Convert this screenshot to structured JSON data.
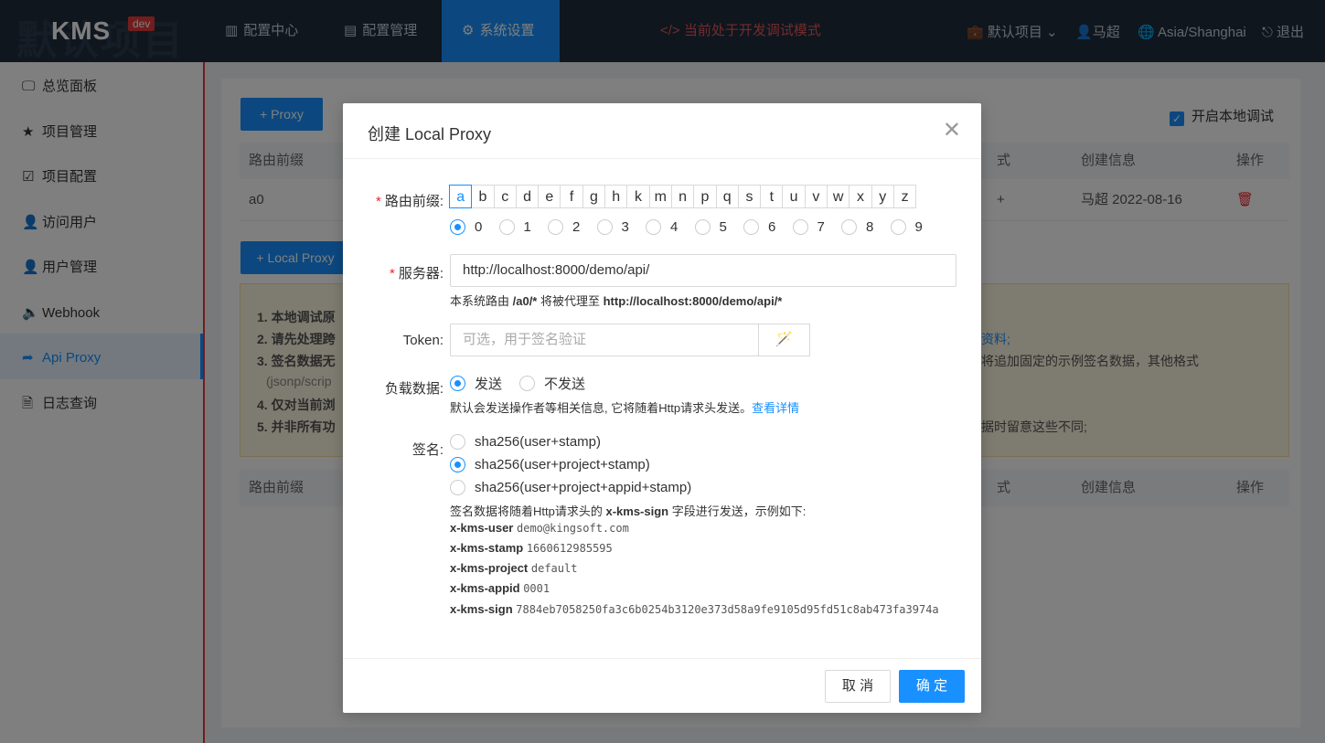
{
  "topbar": {
    "logo_watermark": "默认项目",
    "logo_text": "KMS",
    "logo_badge": "dev",
    "tabs": [
      {
        "icon": "▥",
        "label": "配置中心"
      },
      {
        "icon": "▤",
        "label": "配置管理"
      },
      {
        "icon": "⚙",
        "label": "系统设置"
      }
    ],
    "dev_mode": "</> 当前处于开发调试模式",
    "project": "默认项目",
    "user": "马超",
    "timezone": "Asia/Shanghai",
    "logout": "退出"
  },
  "sidebar": {
    "items": [
      {
        "icon": "🖵",
        "label": "总览面板"
      },
      {
        "icon": "★",
        "label": "项目管理"
      },
      {
        "icon": "☑",
        "label": "项目配置"
      },
      {
        "icon": "👤",
        "label": "访问用户"
      },
      {
        "icon": "👤",
        "label": "用户管理"
      },
      {
        "icon": "🔈",
        "label": "Webhook"
      },
      {
        "icon": "➦",
        "label": "Api Proxy"
      },
      {
        "icon": "🗎",
        "label": "日志查询"
      }
    ]
  },
  "background": {
    "add_proxy": "+ Proxy",
    "add_local_proxy": "+ Local Proxy",
    "local_debug": "开启本地调试",
    "table1": {
      "headers": [
        "路由前缀",
        "式",
        "创建信息",
        "操作"
      ],
      "row": [
        "a0",
        "+",
        "马超 2022-08-16"
      ]
    },
    "notice": [
      "1. 本地调试原",
      "2. 请先处理跨",
      "3. 签名数据无",
      "(jsonp/scrip",
      "4. 仅对当前浏",
      "5. 并非所有功"
    ],
    "notice_right": [
      "资料;",
      "将追加固定的示例签名数据，其他格式",
      "据时留意这些不同;"
    ],
    "table2_headers": [
      "路由前缀",
      "式",
      "创建信息",
      "操作"
    ]
  },
  "modal": {
    "title": "创建 Local Proxy",
    "prefix_label": "路由前缀:",
    "letters": [
      "a",
      "b",
      "c",
      "d",
      "e",
      "f",
      "g",
      "h",
      "k",
      "m",
      "n",
      "p",
      "q",
      "s",
      "t",
      "u",
      "v",
      "w",
      "x",
      "y",
      "z"
    ],
    "selected_letter": "a",
    "digits": [
      "0",
      "1",
      "2",
      "3",
      "4",
      "5",
      "6",
      "7",
      "8",
      "9"
    ],
    "selected_digit": "0",
    "server_label": "服务器:",
    "server_value": "http://localhost:8000/demo/api/",
    "server_hint_pre": "本系统路由 ",
    "server_hint_route": "/a0/*",
    "server_hint_mid": " 将被代理至 ",
    "server_hint_target": "http://localhost:8000/demo/api/*",
    "token_label": "Token:",
    "token_placeholder": "可选，用于签名验证",
    "payload_label": "负载数据:",
    "payload_send": "发送",
    "payload_nosend": "不发送",
    "payload_selected": "发送",
    "payload_hint": "默认会发送操作者等相关信息, 它将随着Http请求头发送。",
    "payload_link": "查看详情",
    "sign_label": "签名:",
    "sign_options": [
      "sha256(user+stamp)",
      "sha256(user+project+stamp)",
      "sha256(user+project+appid+stamp)"
    ],
    "sign_selected": "sha256(user+project+stamp)",
    "sign_hint_pre": "签名数据将随着Http请求头的 ",
    "sign_hint_field": "x-kms-sign",
    "sign_hint_post": " 字段进行发送，示例如下:",
    "headers": [
      {
        "key": "x-kms-user",
        "value": "demo@kingsoft.com"
      },
      {
        "key": "x-kms-stamp",
        "value": "1660612985595"
      },
      {
        "key": "x-kms-project",
        "value": "default"
      },
      {
        "key": "x-kms-appid",
        "value": "0001"
      },
      {
        "key": "x-kms-sign",
        "value": "7884eb7058250fa3c6b0254b3120e373d58a9fe9105d95fd51c8ab473fa3974a"
      }
    ],
    "cancel": "取 消",
    "ok": "确 定"
  }
}
